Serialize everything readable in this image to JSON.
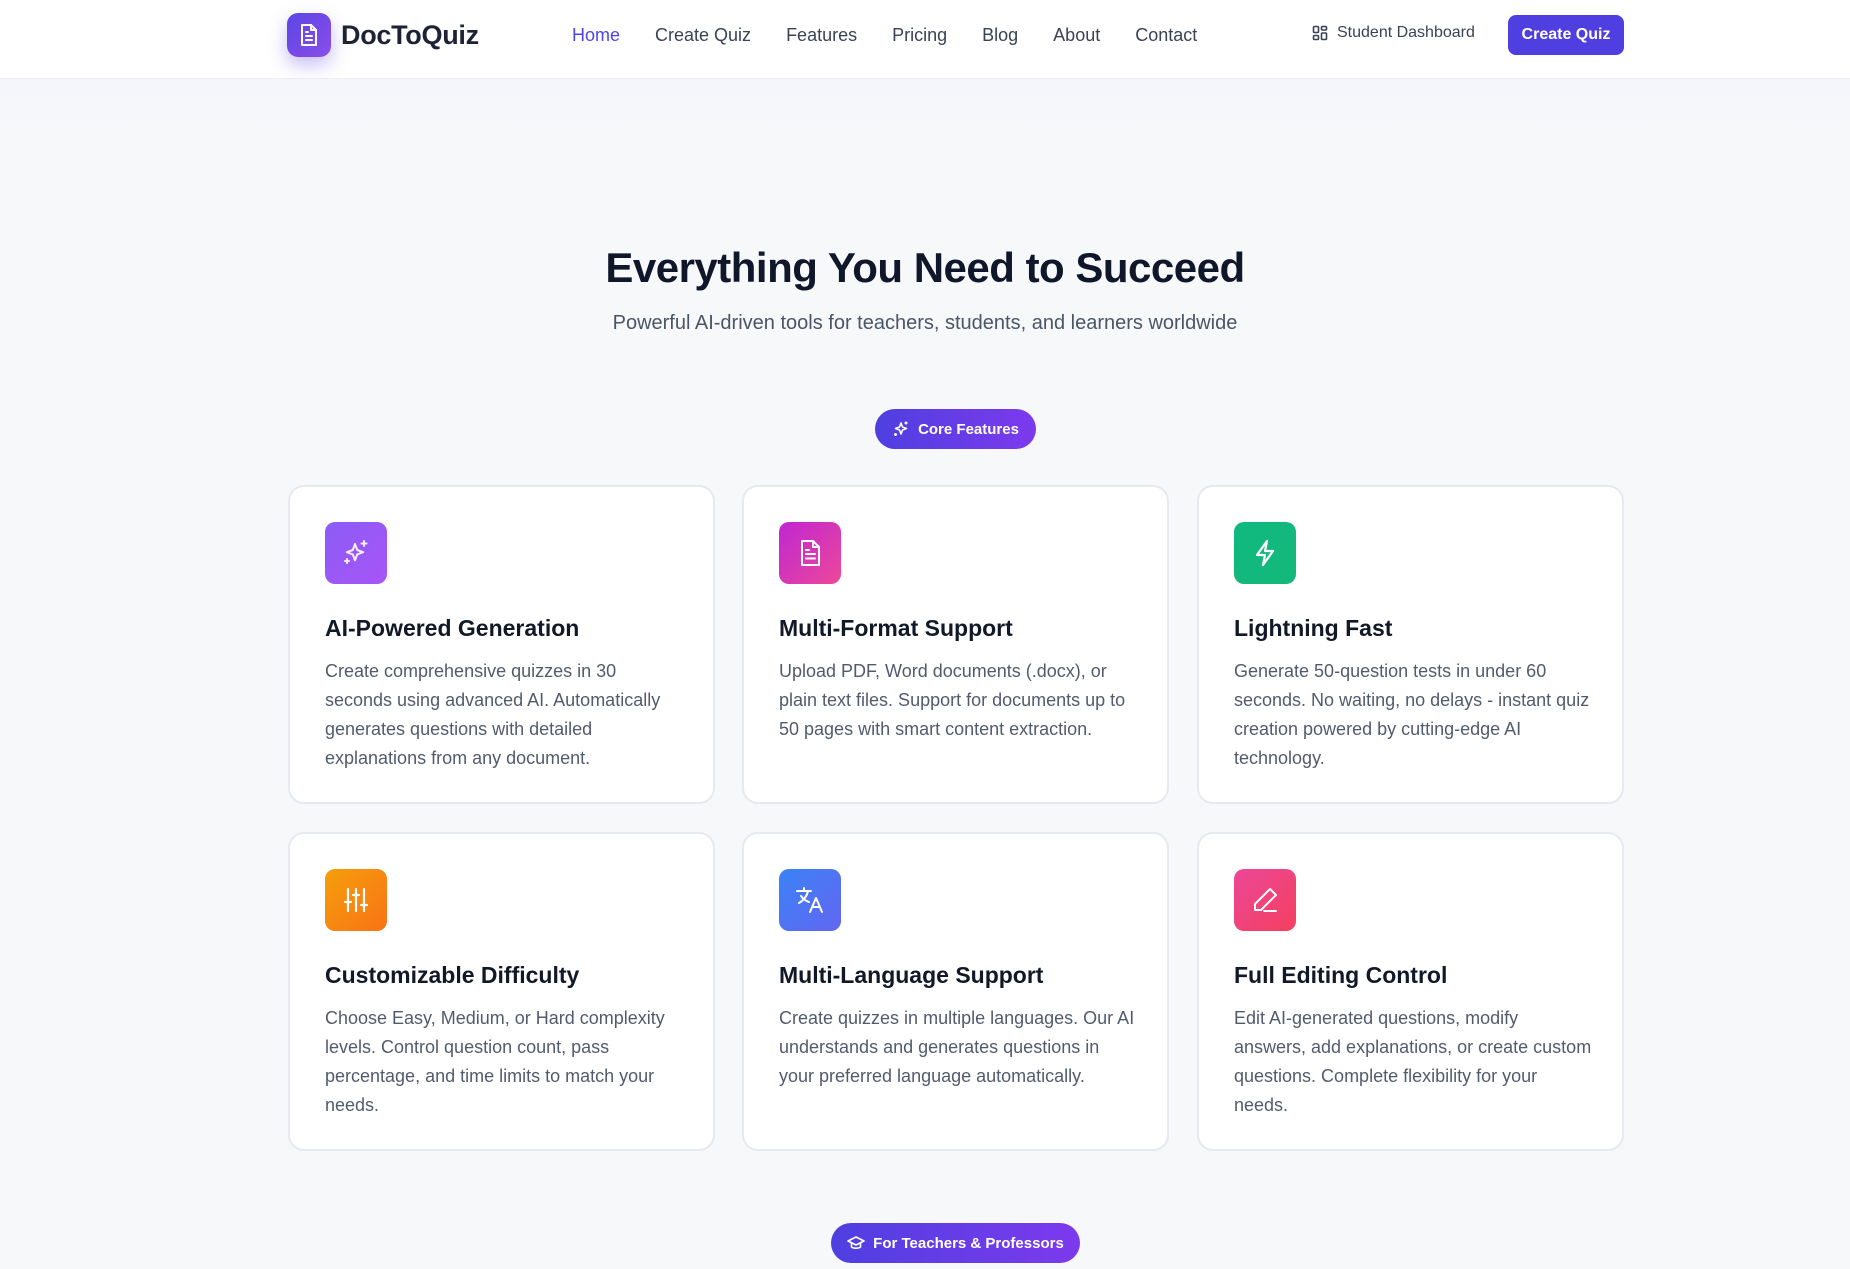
{
  "brand": {
    "name": "DocToQuiz",
    "icon": "document-icon"
  },
  "nav": {
    "items": [
      {
        "label": "Home",
        "active": true
      },
      {
        "label": "Create Quiz",
        "active": false
      },
      {
        "label": "Features",
        "active": false
      },
      {
        "label": "Pricing",
        "active": false
      },
      {
        "label": "Blog",
        "active": false
      },
      {
        "label": "About",
        "active": false
      },
      {
        "label": "Contact",
        "active": false
      }
    ],
    "dashboard_label": "Student Dashboard",
    "cta_label": "Create Quiz"
  },
  "section": {
    "title": "Everything You Need to Succeed",
    "subtitle": "Powerful AI-driven tools for teachers, students, and learners worldwide",
    "core_badge": "Core Features",
    "teachers_badge": "For Teachers & Professors"
  },
  "features": [
    {
      "title": "AI-Powered Generation",
      "description": "Create comprehensive quizzes in 30 seconds using advanced AI. Automatically generates questions with detailed explanations from any document.",
      "icon": "sparkles-icon",
      "color": "#8b5cf6"
    },
    {
      "title": "Multi-Format Support",
      "description": "Upload PDF, Word documents (.docx), or plain text files. Support for documents up to 50 pages with smart content extraction.",
      "icon": "file-text-icon",
      "color": "#d946ef"
    },
    {
      "title": "Lightning Fast",
      "description": "Generate 50-question tests in under 60 seconds. No waiting, no delays - instant quiz creation powered by cutting-edge AI technology.",
      "icon": "lightning-icon",
      "color": "#10b981"
    },
    {
      "title": "Customizable Difficulty",
      "description": "Choose Easy, Medium, or Hard complexity levels. Control question count, pass percentage, and time limits to match your needs.",
      "icon": "sliders-icon",
      "color": "#f59e0b"
    },
    {
      "title": "Multi-Language Support",
      "description": "Create quizzes in multiple languages. Our AI understands and generates questions in your preferred language automatically.",
      "icon": "translate-icon",
      "color": "#4f6bed"
    },
    {
      "title": "Full Editing Control",
      "description": "Edit AI-generated questions, modify answers, add explanations, or create custom questions. Complete flexibility for your needs.",
      "icon": "pencil-icon",
      "color": "#ec4899"
    }
  ]
}
